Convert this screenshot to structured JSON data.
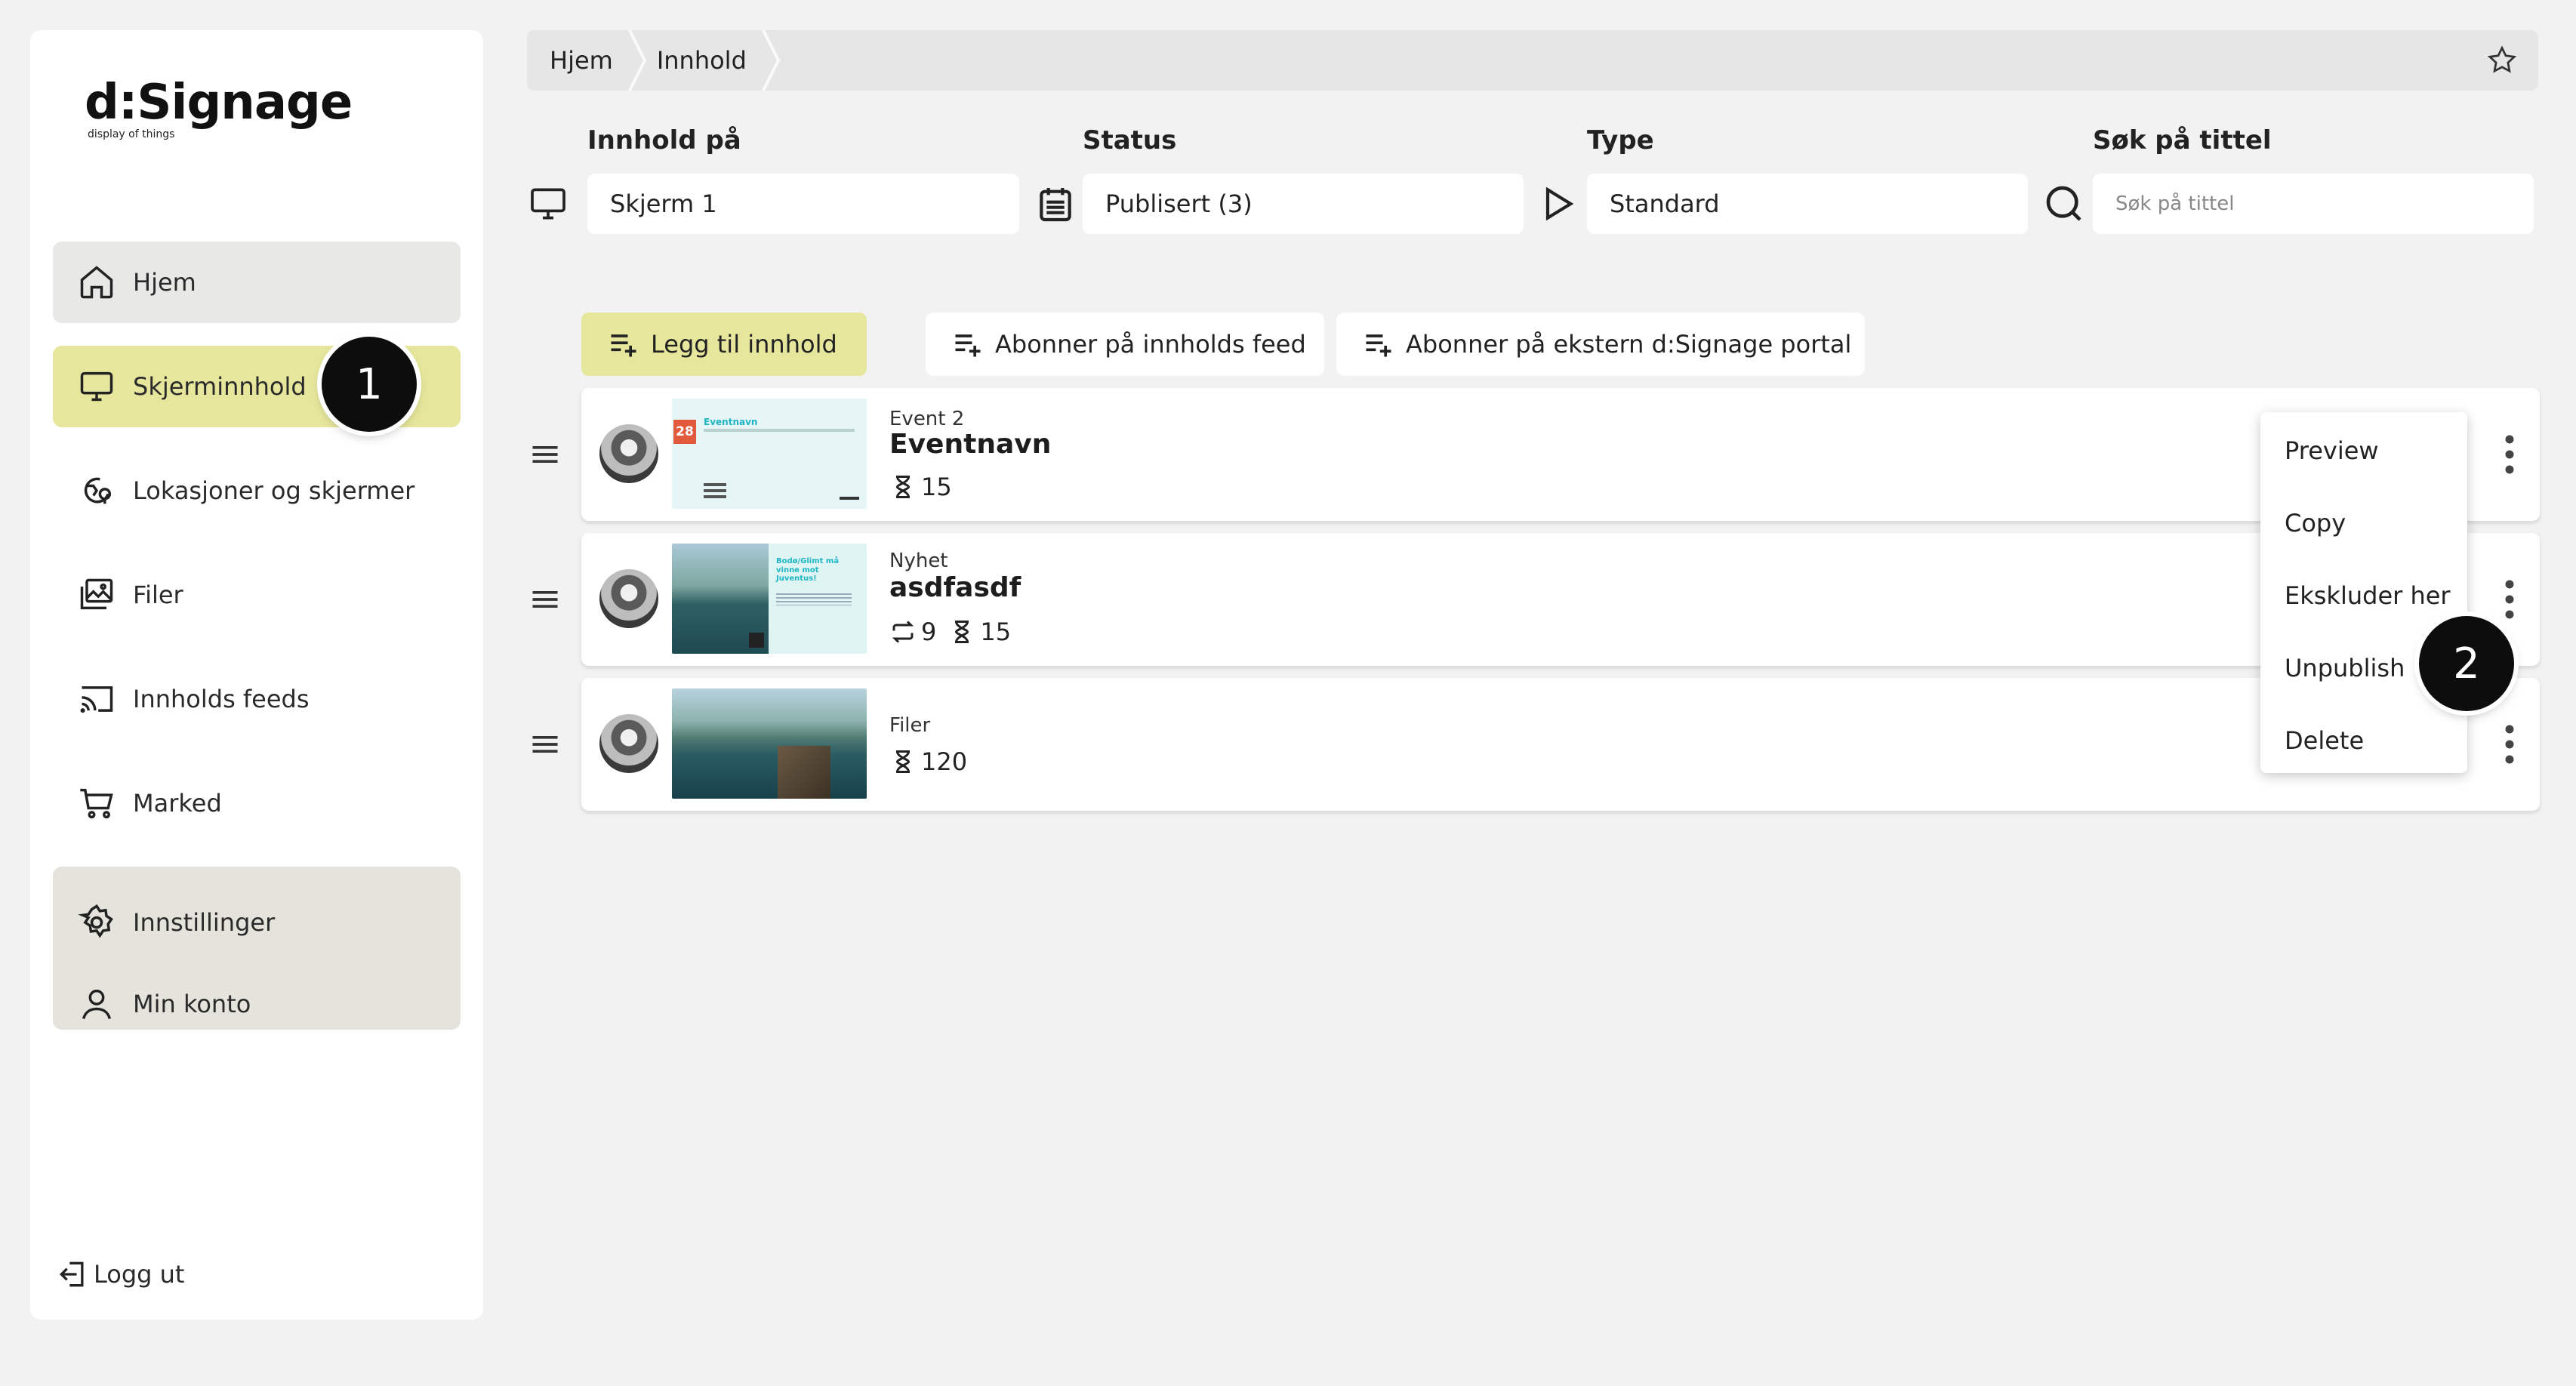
{
  "logo": {
    "main": "d:Signage",
    "sub": "display of things"
  },
  "sidebar": {
    "items": [
      {
        "label": "Hjem",
        "icon": "home-icon"
      },
      {
        "label": "Skjerminnhold",
        "icon": "monitor-icon"
      },
      {
        "label": "Lokasjoner og skjermer",
        "icon": "location-icon"
      },
      {
        "label": "Filer",
        "icon": "images-icon"
      },
      {
        "label": "Innholds feeds",
        "icon": "cast-icon"
      },
      {
        "label": "Marked",
        "icon": "cart-icon"
      },
      {
        "label": "Innstillinger",
        "icon": "gear-icon"
      },
      {
        "label": "Min konto",
        "icon": "user-icon"
      }
    ],
    "logout": "Logg ut"
  },
  "badges": {
    "first": "1",
    "second": "2"
  },
  "breadcrumb": {
    "items": [
      "Hjem",
      "Innhold"
    ]
  },
  "filters": {
    "content_on": {
      "label": "Innhold på",
      "value": "Skjerm 1"
    },
    "status": {
      "label": "Status",
      "value": "Publisert (3)"
    },
    "type": {
      "label": "Type",
      "value": "Standard"
    },
    "search": {
      "label": "Søk på tittel",
      "placeholder": "Søk på tittel"
    }
  },
  "actions": {
    "add": "Legg til innhold",
    "subscribe_feed": "Abonner på innholds feed",
    "subscribe_portal": "Abonner på ekstern d:Signage portal"
  },
  "rows": [
    {
      "type": "Event 2",
      "title": "Eventnavn",
      "duration": "15",
      "thumb": {
        "date": "28",
        "heading": "Eventnavn"
      }
    },
    {
      "type": "Nyhet",
      "title": "asdfasdf",
      "repeat": "9",
      "duration": "15",
      "thumb": {
        "heading": "Bodø/Glimt må vinne mot Juventus!"
      }
    },
    {
      "type": "Filer",
      "title": "",
      "duration": "120"
    }
  ],
  "context_menu": {
    "items": [
      "Preview",
      "Copy",
      "Ekskluder her",
      "Unpublish",
      "Delete"
    ]
  },
  "colors": {
    "accent": "#e6e79c",
    "settings_bg": "#e4e3dc",
    "badge": "#0d0d0d",
    "event_red": "#e25a3c",
    "teal": "#1fb5c4"
  }
}
